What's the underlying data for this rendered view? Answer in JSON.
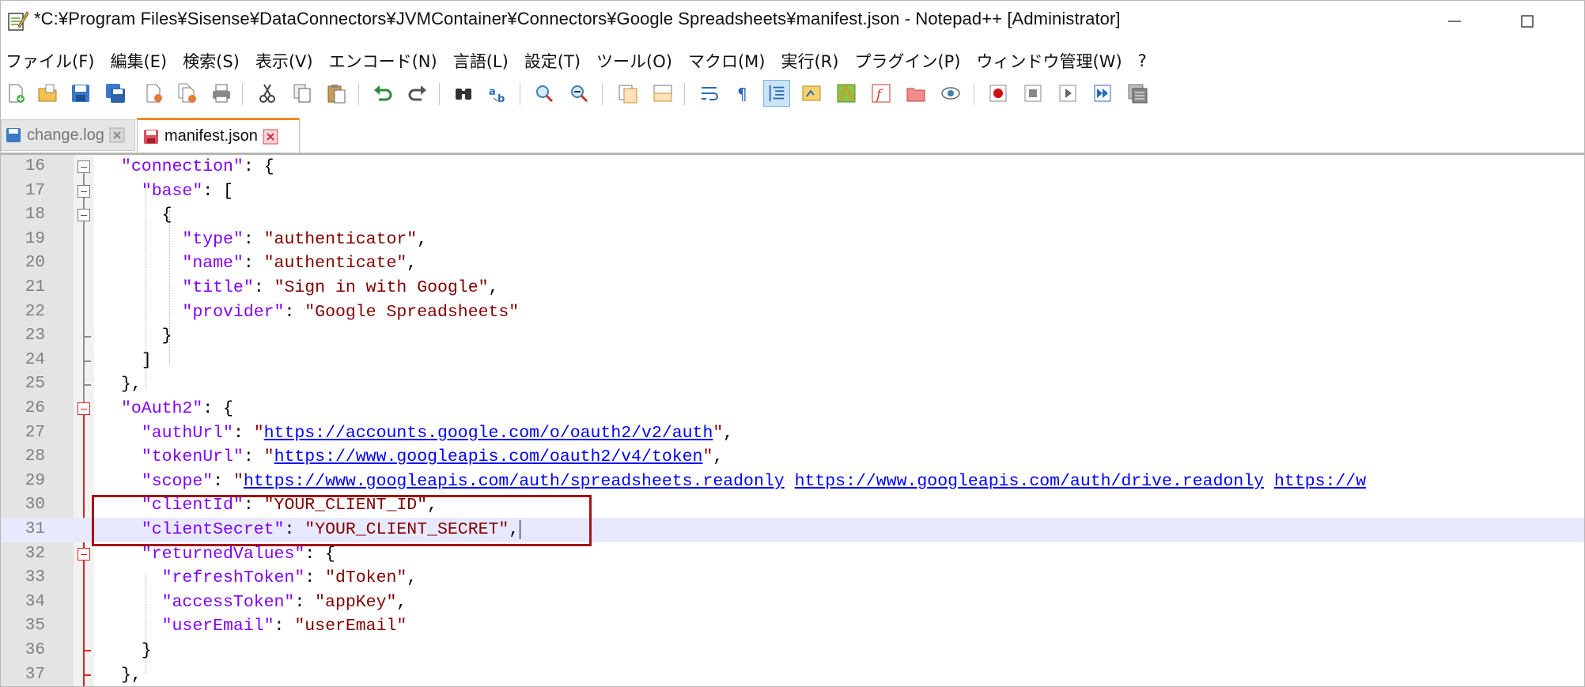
{
  "window": {
    "title": "*C:¥Program Files¥Sisense¥DataConnectors¥JVMContainer¥Connectors¥Google Spreadsheets¥manifest.json - Notepad++ [Administrator]",
    "minimize_glyph": "—",
    "maximize_glyph": "☐"
  },
  "menu": {
    "items": [
      "ファイル(F)",
      "編集(E)",
      "検索(S)",
      "表示(V)",
      "エンコード(N)",
      "言語(L)",
      "設定(T)",
      "ツール(O)",
      "マクロ(M)",
      "実行(R)",
      "プラグイン(P)",
      "ウィンドウ管理(W)",
      "?"
    ]
  },
  "tabs": [
    {
      "label": "change.log",
      "active": false
    },
    {
      "label": "manifest.json",
      "active": true
    }
  ],
  "editor": {
    "lines": [
      {
        "num": "16"
      },
      {
        "num": "17"
      },
      {
        "num": "18"
      },
      {
        "num": "19"
      },
      {
        "num": "20"
      },
      {
        "num": "21"
      },
      {
        "num": "22"
      },
      {
        "num": "23"
      },
      {
        "num": "24"
      },
      {
        "num": "25"
      },
      {
        "num": "26"
      },
      {
        "num": "27"
      },
      {
        "num": "28"
      },
      {
        "num": "29"
      },
      {
        "num": "30"
      },
      {
        "num": "31"
      },
      {
        "num": "32"
      },
      {
        "num": "33"
      },
      {
        "num": "34"
      },
      {
        "num": "35"
      },
      {
        "num": "36"
      },
      {
        "num": "37"
      }
    ],
    "current_line": "31",
    "highlighted_lines": [
      "30",
      "31"
    ],
    "tokens": {
      "connection": "\"connection\"",
      "base": "\"base\"",
      "type_k": "\"type\"",
      "type_v": "\"authenticator\"",
      "name_k": "\"name\"",
      "name_v": "\"authenticate\"",
      "title_k": "\"title\"",
      "title_v": "\"Sign in with Google\"",
      "provider_k": "\"provider\"",
      "provider_v": "\"Google Spreadsheets\"",
      "oauth2": "\"oAuth2\"",
      "authUrl_k": "\"authUrl\"",
      "authUrl_v": "https://accounts.google.com/o/oauth2/v2/auth",
      "tokenUrl_k": "\"tokenUrl\"",
      "tokenUrl_v": "https://www.googleapis.com/oauth2/v4/token",
      "scope_k": "\"scope\"",
      "scope_v1": "https://www.googleapis.com/auth/spreadsheets.readonly",
      "scope_v2": "https://www.googleapis.com/auth/drive.readonly",
      "scope_v3": "https://w",
      "clientId_k": "\"clientId\"",
      "clientId_v": "\"YOUR_CLIENT_ID\"",
      "clientSecret_k": "\"clientSecret\"",
      "clientSecret_v": "\"YOUR_CLIENT_SECRET\"",
      "returnedValues": "\"returnedValues\"",
      "refreshToken_k": "\"refreshToken\"",
      "refreshToken_v": "\"dToken\"",
      "accessToken_k": "\"accessToken\"",
      "accessToken_v": "\"appKey\"",
      "userEmail_k": "\"userEmail\"",
      "userEmail_v": "\"userEmail\""
    }
  },
  "colors": {
    "key": "#8000ff",
    "string": "#800000",
    "url": "#0000ff",
    "highlight_box": "#a31515",
    "active_tab_accent": "#f08a24"
  },
  "icons": [
    "notepad-icon",
    "new-file-icon",
    "open-file-icon",
    "save-icon",
    "save-all-icon",
    "close-icon",
    "close-all-icon",
    "print-icon",
    "cut-icon",
    "copy-icon",
    "paste-icon",
    "undo-icon",
    "redo-icon",
    "find-icon",
    "replace-icon",
    "zoom-in-icon",
    "zoom-out-icon",
    "sync-v-icon",
    "sync-h-icon",
    "word-wrap-icon",
    "show-all-chars-icon",
    "indent-guide-icon",
    "udl-icon",
    "doc-map-icon",
    "function-list-icon",
    "folder-workspace-icon",
    "monitoring-icon",
    "record-macro-icon",
    "stop-macro-icon",
    "play-macro-icon",
    "run-macro-multiple-icon",
    "save-macro-icon"
  ]
}
